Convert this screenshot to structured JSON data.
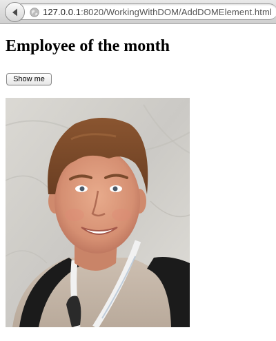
{
  "browser": {
    "url_host": "127.0.0.1",
    "url_path": ":8020/WorkingWithDOM/AddDOMElement.html",
    "back_icon": "back-arrow-icon",
    "site_icon": "globe-icon"
  },
  "page": {
    "title": "Employee of the month",
    "button_label": "Show me"
  },
  "photo": {
    "description_icon": "employee-photo"
  },
  "colors": {
    "background": "#ffffff",
    "text": "#000000"
  }
}
